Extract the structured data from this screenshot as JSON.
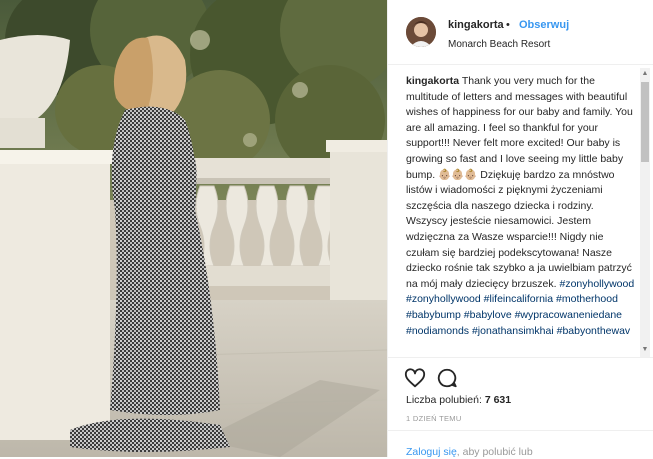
{
  "post": {
    "username": "kingakorta",
    "separator": "•",
    "follow_label": "Obserwuj",
    "location": "Monarch Beach Resort"
  },
  "caption": {
    "username": "kingakorta",
    "text_en": "Thank you very much for the multitude of letters and messages with beautiful wishes of happiness for our baby and family. You are all amazing. I feel so thankful for your support!!! Never felt more excited! Our baby is growing so fast and I love seeing my little baby bump.",
    "emoji": "👶🏼👶🏼👶🏼",
    "text_pl": "Dziękuję bardzo za mnóstwo listów i wiadomości z pięknymi życzeniami szczęścia dla naszego dziecka i rodziny. Wszyscy jesteście niesamowici. Jestem wdzięczna za Wasze wsparcie!!! Nigdy nie czułam się bardziej podekscytowana! Nasze dziecko rośnie tak szybko a ja uwielbiam patrzyć na mój mały dziecięcy brzuszek.",
    "hashtags": [
      "#zonyhollywood",
      "#zonyhollywood",
      "#lifeincalifornia",
      "#motherhood",
      "#babybump",
      "#babylove",
      "#wypracowaneniedane",
      "#nodiamonds",
      "#jonathansimkhai",
      "#babyonthewav"
    ]
  },
  "stats": {
    "likes_label": "Liczba polubień:",
    "likes_count": "7 631",
    "time": "1 DZIEŃ TEMU"
  },
  "footer": {
    "login_link": "Zaloguj się",
    "login_rest": ", aby polubić lub"
  },
  "icons": {
    "like": "heart-icon",
    "comment": "comment-icon"
  },
  "colors": {
    "link": "#3897f0",
    "hashtag": "#003569",
    "text": "#262626",
    "muted": "#999999"
  }
}
